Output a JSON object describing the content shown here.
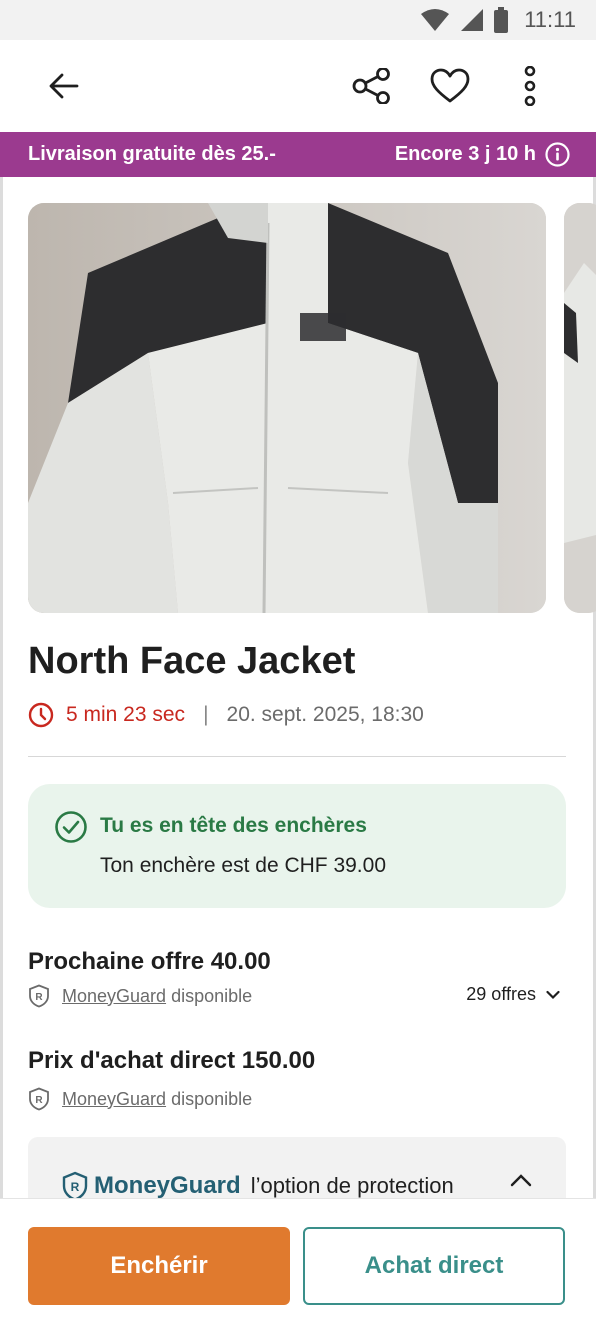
{
  "status_bar": {
    "time": "11:11"
  },
  "app_bar": {
    "icons": [
      "back-arrow-icon",
      "share-icon",
      "heart-icon",
      "more-vert-icon"
    ]
  },
  "promo": {
    "left": "Livraison gratuite dès 25.-",
    "right": "Encore 3 j 10 h",
    "bg_color": "#9b3a8f"
  },
  "product": {
    "title": "North Face Jacket",
    "countdown": "5 min 23 sec",
    "separator": "|",
    "end_date": "20. sept. 2025, 18:30"
  },
  "lead_box": {
    "heading": "Tu es en tête des enchères",
    "subtext": "Ton enchère est de CHF 39.00"
  },
  "next_offer": {
    "title": "Prochaine offre 40.00",
    "mg_link": "MoneyGuard",
    "mg_suffix": "disponible",
    "offers_count": "29 offres"
  },
  "direct_buy": {
    "title": "Prix d'achat direct 150.00",
    "mg_link": "MoneyGuard",
    "mg_suffix": "disponible"
  },
  "moneyguard_panel": {
    "brand": "MoneyGuard",
    "tagline": "l’option de protection"
  },
  "actions": {
    "bid_label": "Enchérir",
    "buy_label": "Achat direct",
    "bid_color": "#e07a2e",
    "buy_color": "#3a8f8a"
  }
}
